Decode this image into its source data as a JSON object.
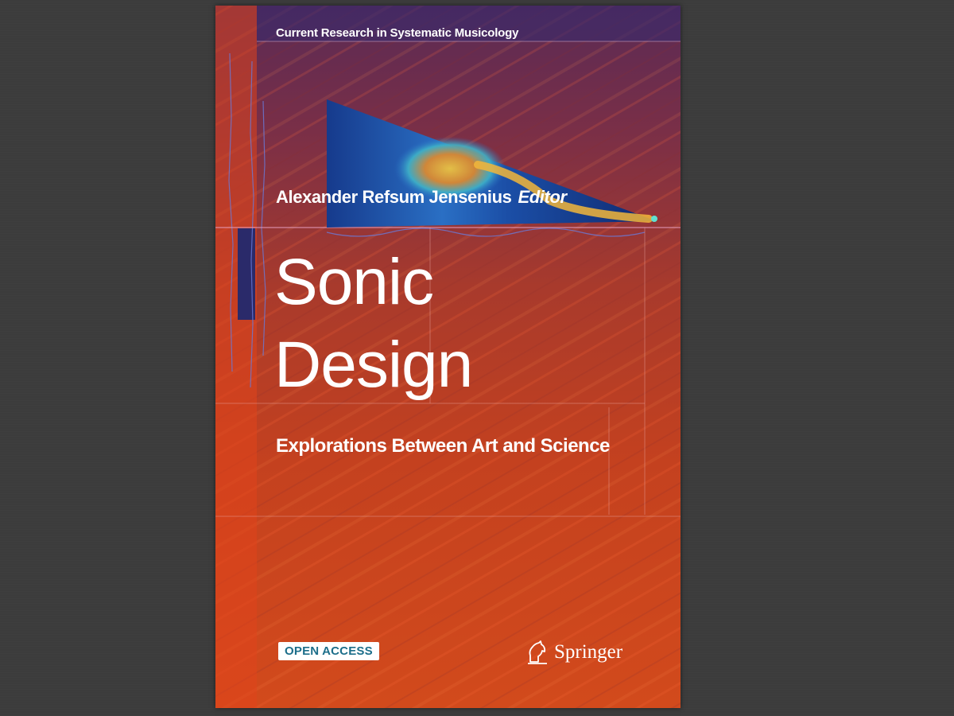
{
  "cover": {
    "series": "Current Research in Systematic Musicology",
    "author": "Alexander Refsum Jensenius",
    "role": "Editor",
    "title_line1": "Sonic",
    "title_line2": "Design",
    "subtitle": "Explorations Between Art and Science",
    "badge": "OPEN ACCESS",
    "publisher": "Springer",
    "icons": [
      "springer-horse-icon"
    ],
    "colors": {
      "top": "#5a2a55",
      "bottom": "#d24a1c",
      "badge_text": "#1c6e8a"
    }
  }
}
